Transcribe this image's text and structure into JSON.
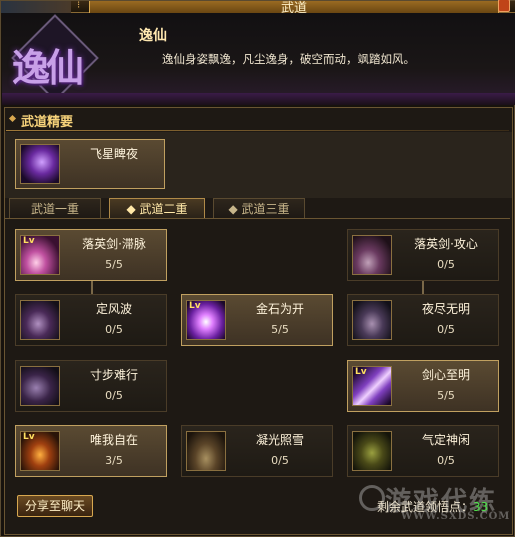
{
  "window": {
    "title": "武道"
  },
  "header": {
    "emblem_text": "逸仙",
    "skill_name": "逸仙",
    "skill_desc": "逸仙身姿飘逸，凡尘逸身，破空而动，飒踏如风。"
  },
  "essence": {
    "title": "武道精要",
    "item": {
      "name": "飞星睥夜"
    }
  },
  "tabs": [
    {
      "label": "武道一重",
      "active": false
    },
    {
      "label": "武道二重",
      "active": true
    },
    {
      "label": "武道三重",
      "active": false
    }
  ],
  "nodes": [
    {
      "name": "落英剑·滞脉",
      "level": "5/5",
      "active": true
    },
    {
      "name": "落英剑·攻心",
      "level": "0/5",
      "active": false
    },
    {
      "name": "定风波",
      "level": "0/5",
      "active": false
    },
    {
      "name": "金石为开",
      "level": "5/5",
      "active": true
    },
    {
      "name": "夜尽无明",
      "level": "0/5",
      "active": false
    },
    {
      "name": "寸步难行",
      "level": "0/5",
      "active": false
    },
    {
      "name": "剑心至明",
      "level": "5/5",
      "active": true
    },
    {
      "name": "唯我自在",
      "level": "3/5",
      "active": true
    },
    {
      "name": "凝光照雪",
      "level": "0/5",
      "active": false
    },
    {
      "name": "气定神闲",
      "level": "0/5",
      "active": false
    }
  ],
  "footer": {
    "share_label": "分享至聊天",
    "remaining_label": "剩余武道领悟点：",
    "remaining_value": "33"
  },
  "watermark": {
    "brand": "游戏代练",
    "site": "WWW.SXDS.COM"
  },
  "colors": {
    "accent_gold": "#d8a850",
    "active_panel": "#5a4a32",
    "purple_glow": "#a050e0",
    "points_green": "#4ee04a"
  }
}
